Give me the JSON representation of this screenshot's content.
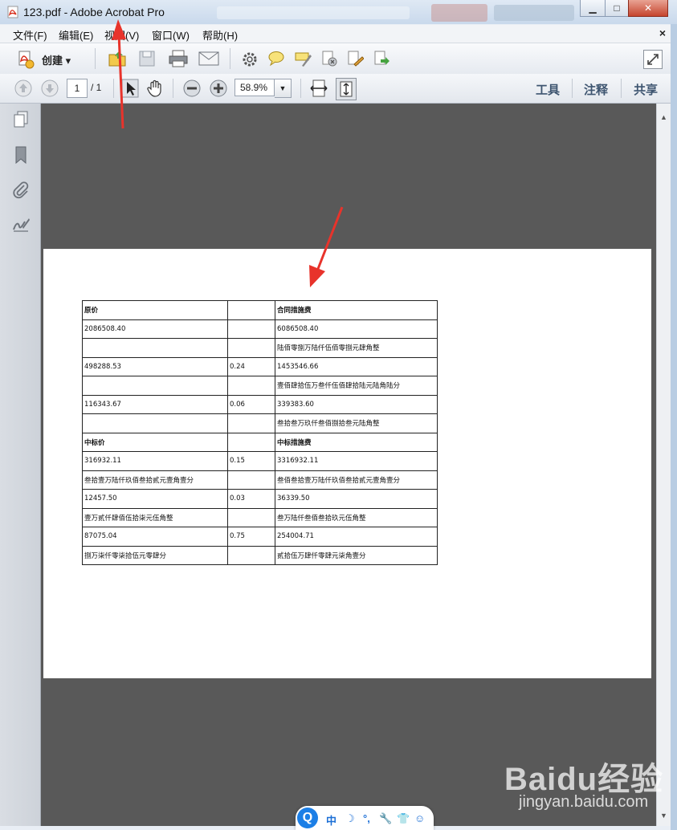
{
  "window": {
    "title": "123.pdf - Adobe Acrobat Pro",
    "minimize_glyph": "▁",
    "maximize_glyph": "□",
    "close_glyph": "✕"
  },
  "menu": {
    "items": [
      "文件(F)",
      "编辑(E)",
      "视图(V)",
      "窗口(W)",
      "帮助(H)"
    ],
    "close_glyph": "×"
  },
  "toolbar": {
    "create_label": "创建",
    "create_arrow": "▾"
  },
  "nav": {
    "current_page": "1",
    "total_pages": "/ 1",
    "zoom": "58.9%",
    "zoom_arrow": "▼"
  },
  "right_links": [
    "工具",
    "注释",
    "共享"
  ],
  "scrollbar": {
    "up": "▲",
    "down": "▼"
  },
  "pdf_table": {
    "rows": [
      [
        "原价",
        "",
        "合同措施费"
      ],
      [
        "2086508.40",
        "",
        "6086508.40"
      ],
      [
        "",
        "",
        "陆佰零捌万陆仟伍佰零捌元肆角整"
      ],
      [
        "498288.53",
        "0.24",
        "1453546.66"
      ],
      [
        "",
        "",
        "壹佰肆拾伍万叁仟伍佰肆拾陆元陆角陆分"
      ],
      [
        "116343.67",
        "0.06",
        "339383.60"
      ],
      [
        "",
        "",
        "叁拾叁万玖仟叁佰捌拾叁元陆角整"
      ],
      [
        "中标价",
        "",
        "中标措施费"
      ],
      [
        "316932.11",
        "0.15",
        "3316932.11"
      ],
      [
        "叁拾壹万陆仟玖佰叁拾贰元壹角壹分",
        "",
        "叁佰叁拾壹万陆仟玖佰叁拾贰元壹角壹分"
      ],
      [
        "12457.50",
        "0.03",
        "36339.50"
      ],
      [
        "壹万贰仟肆佰伍拾柒元伍角整",
        "",
        "叁万陆仟叁佰叁拾玖元伍角整"
      ],
      [
        "87075.04",
        "0.75",
        "254004.71"
      ],
      [
        "捌万柒仟零柒拾伍元零肆分",
        "",
        "贰拾伍万肆仟零肆元柒角壹分"
      ]
    ],
    "bold_rows": [
      0,
      7
    ]
  },
  "watermark": {
    "logo": "Baidu经验",
    "sub": "jingyan.baidu.com"
  },
  "ime": {
    "q": "Q",
    "items": [
      "中",
      "☽",
      "°,",
      "🔧",
      "👕",
      "☺"
    ]
  },
  "colors": {
    "doc_bg": "#595959",
    "annotation_arrow": "#e8332b",
    "ime_blue": "#1c7fe6"
  }
}
